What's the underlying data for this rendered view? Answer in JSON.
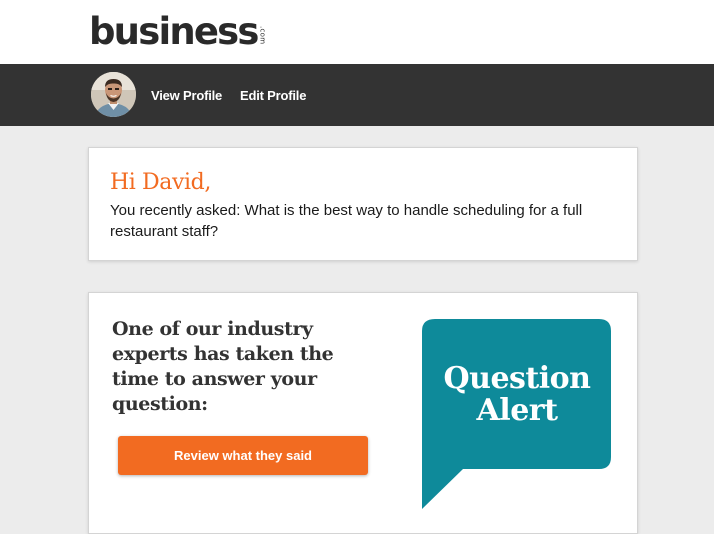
{
  "brand": {
    "name": "business",
    "tld": ".com"
  },
  "nav": {
    "avatar_icon": "user-avatar",
    "view_profile": "View Profile",
    "edit_profile": "Edit Profile"
  },
  "greeting": {
    "title": "Hi David,",
    "message": "You recently asked: What is the best way to handle scheduling for a full restaurant staff?"
  },
  "alert": {
    "heading": "One of our industry experts has taken the time to answer your question:",
    "cta_label": "Review what they said",
    "bubble_line1": "Question",
    "bubble_line2": "Alert",
    "bubble_icon": "speech-bubble-icon"
  },
  "colors": {
    "accent_orange": "#f26b21",
    "bubble_teal": "#0e8a9a",
    "nav_dark": "#333333"
  }
}
